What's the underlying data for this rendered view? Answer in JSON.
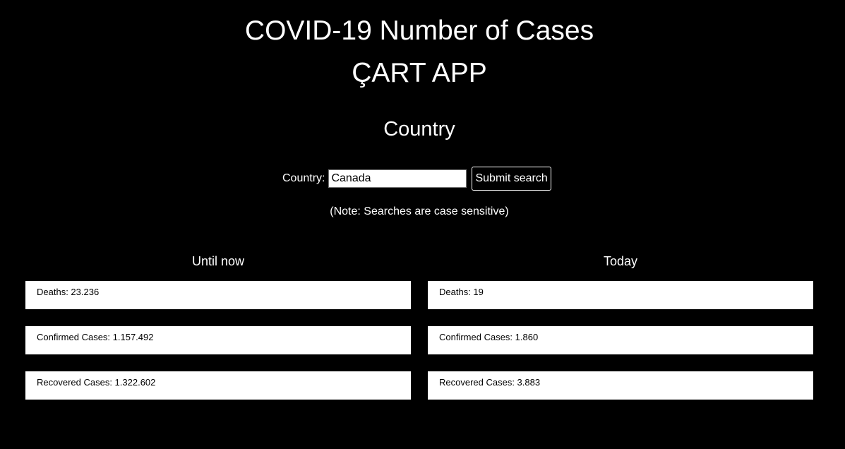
{
  "header": {
    "title_line1": "COVID-19 Number of Cases",
    "title_line2": "ÇART APP",
    "section_title": "Country"
  },
  "search": {
    "label": "Country:",
    "value": "Canada",
    "button_label": "Submit search",
    "note": "(Note: Searches are case sensitive)"
  },
  "until_now": {
    "heading": "Until now",
    "deaths": "Deaths: 23.236",
    "confirmed": "Confirmed Cases: 1.157.492",
    "recovered": "Recovered Cases: 1.322.602"
  },
  "today": {
    "heading": "Today",
    "deaths": "Deaths: 19",
    "confirmed": "Confirmed Cases: 1.860",
    "recovered": "Recovered Cases: 3.883"
  }
}
